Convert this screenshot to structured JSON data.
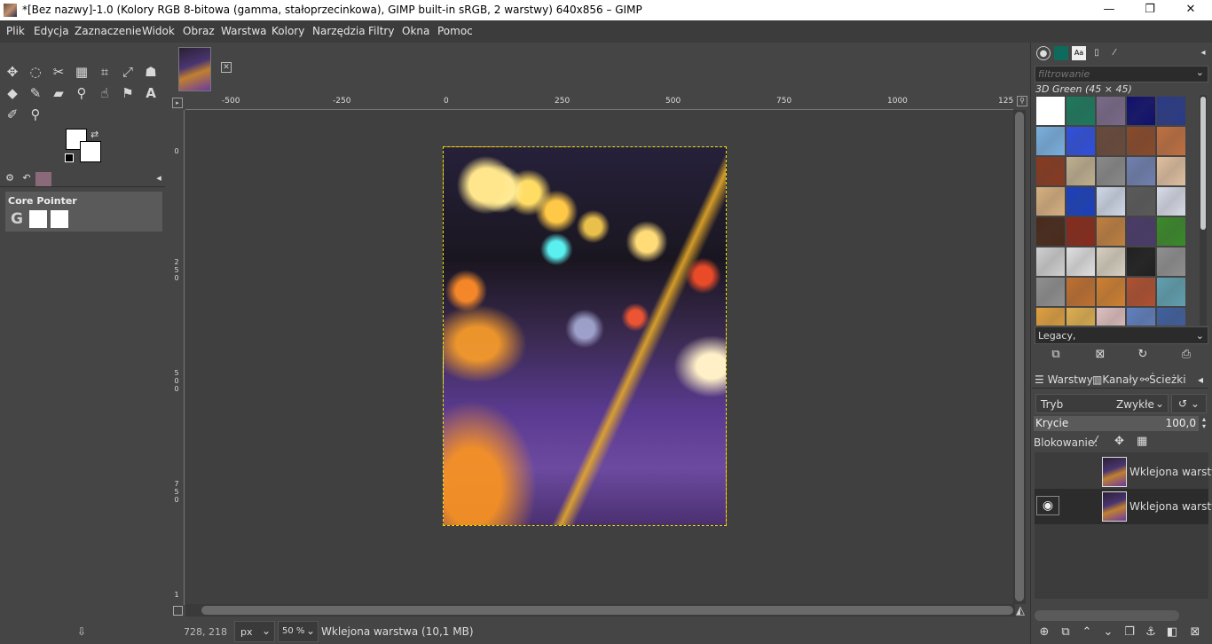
{
  "window": {
    "title": "*[Bez nazwy]-1.0 (Kolory RGB 8-bitowa (gamma, stałoprzecinkowa), GIMP built-in sRGB, 2 warstwy) 640x856 – GIMP",
    "minimize": "—",
    "maximize": "❐",
    "close": "✕"
  },
  "menu": [
    "Plik",
    "Edycja",
    "Zaznaczenie",
    "Widok",
    "Obraz",
    "Warstwa",
    "Kolory",
    "Narzędzia",
    "Filtry",
    "Okna",
    "Pomoc"
  ],
  "toolbox": {
    "device_status_title": "Core Pointer",
    "device_icon": "G"
  },
  "rulers": {
    "horizontal": [
      "-500",
      "-250",
      "0",
      "250",
      "500",
      "750",
      "1000",
      "125"
    ],
    "vertical": [
      "0",
      "2\n5\n0",
      "5\n0\n0",
      "7\n5\n0",
      "1"
    ]
  },
  "patterns": {
    "filter_placeholder": "filtrowanie",
    "selected_name": "3D Green (45 × 45)",
    "tag_value": "Legacy,"
  },
  "layers_panel": {
    "tab_layers": "Warstwy",
    "tab_channels": "Kanały",
    "tab_paths": "Ścieżki",
    "mode_label": "Tryb",
    "mode_value": "Zwykłe",
    "opacity_label": "Krycie",
    "opacity_value": "100,0",
    "lock_label": "Blokowanie:",
    "layers": [
      {
        "name": "Wklejona warstwa",
        "visible": false
      },
      {
        "name": "Wklejona warstwa",
        "visible": true
      }
    ]
  },
  "statusbar": {
    "coords": "728, 218",
    "unit": "px",
    "zoom": "50 %",
    "message": "Wklejona warstwa (10,1 MB)"
  },
  "colors": {
    "background": "#454545",
    "canvas": "#404040",
    "selection_marching_ants": "#e8e400"
  }
}
